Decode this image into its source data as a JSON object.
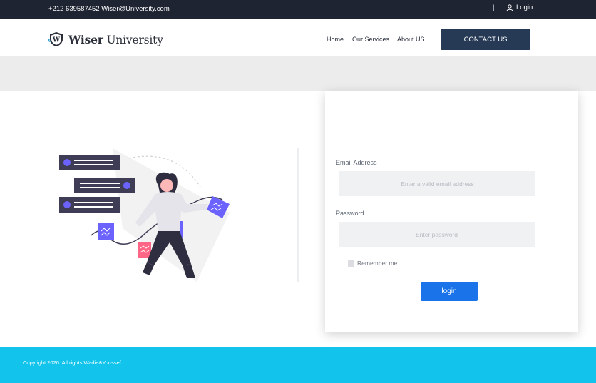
{
  "topbar": {
    "contact": "+212 639587452 Wiser@University.com",
    "separator": "|",
    "login": "Login"
  },
  "header": {
    "brand_bold": "Wiser",
    "brand_light": " University",
    "nav": [
      "Home",
      "Our Services",
      "About US"
    ],
    "cta": "CONTACT US"
  },
  "form": {
    "email_label": "Email Address",
    "email_placeholder": "Enter a valid email address",
    "password_label": "Password",
    "password_placeholder": "Enter password",
    "remember": "Remember me",
    "submit": "login"
  },
  "footer": {
    "copyright": "Copyright 2020. All rights Wadie&Youssef."
  },
  "colors": {
    "accent": "#12c4ec",
    "dark": "#1f2433",
    "button": "#1a73e8",
    "illustration": "#6c63ff"
  },
  "icons": [
    "user-icon",
    "shield-logo-icon"
  ]
}
